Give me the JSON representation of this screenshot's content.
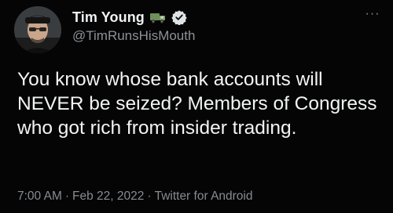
{
  "author": {
    "display_name": "Tim Young",
    "handle": "@TimRunsHisMouth",
    "badge_icon": "truck-emoji-icon",
    "verified_icon": "verified-badge-icon"
  },
  "menu": {
    "more_icon": "more-horizontal-icon",
    "more_label": "···"
  },
  "tweet": {
    "text": "You know whose bank accounts will NEVER be seized?  Members of Congress who got rich from insider trading."
  },
  "meta": {
    "time": "7:00 AM",
    "separator": "·",
    "date": "Feb 22, 2022",
    "source": "Twitter for Android"
  },
  "colors": {
    "background": "#000000",
    "text": "#f2f4f5",
    "secondary": "#858c92",
    "verified": "#dfe3e6"
  }
}
